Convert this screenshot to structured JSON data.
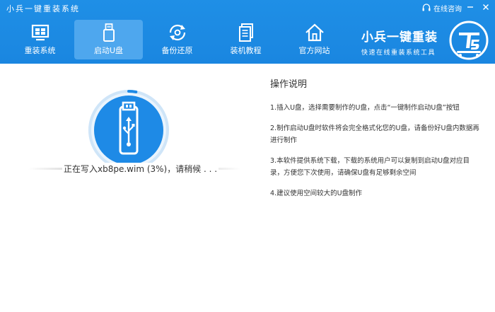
{
  "window": {
    "title": "小兵一键重装系统",
    "consult_label": "在线咨询",
    "min_symbol": "—",
    "close_symbol": "✕"
  },
  "nav": {
    "items": [
      {
        "label": "重装系统",
        "icon": "monitor-icon",
        "active": false
      },
      {
        "label": "启动U盘",
        "icon": "usb-drive-icon",
        "active": true
      },
      {
        "label": "备份还原",
        "icon": "backup-restore-icon",
        "active": false
      },
      {
        "label": "装机教程",
        "icon": "tutorial-document-icon",
        "active": false
      },
      {
        "label": "官方网站",
        "icon": "home-icon",
        "active": false
      }
    ]
  },
  "brand": {
    "title": "小兵一键重装",
    "subtitle": "快速在线重装系统工具"
  },
  "progress": {
    "status_text": "正在写入xb8pe.wim (3%)，请稍候 . . .",
    "percent": 3
  },
  "instructions": {
    "title": "操作说明",
    "items": [
      "1.插入U盘，选择需要制作的U盘，点击“一键制作启动U盘”按钮",
      "2.制作启动U盘时软件将会完全格式化您的U盘，请备份好U盘内数据再进行制作",
      "3.本软件提供系统下载，下载的系统用户可以复制到启动U盘对应目录，方便您下次使用，请确保U盘有足够剩余空间",
      "4.建议使用空间较大的U盘制作"
    ]
  },
  "colors": {
    "header_blue": "#1a86e0",
    "active_tab": "#4ea7ee",
    "accent": "#1e8ae6"
  }
}
